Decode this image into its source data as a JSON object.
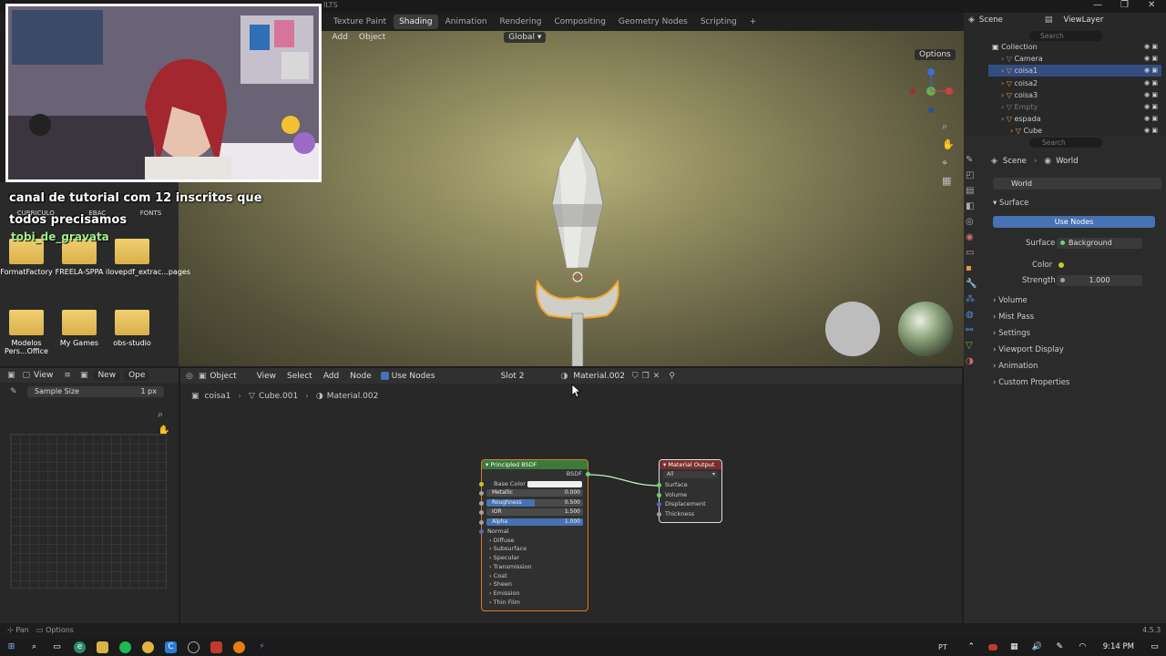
{
  "titlebar": {
    "title_fragment": "ILTS",
    "minimize": "—",
    "restore": "❐",
    "close": "✕"
  },
  "workspace_tabs": [
    "Texture Paint",
    "Shading",
    "Animation",
    "Rendering",
    "Compositing",
    "Geometry Nodes",
    "Scripting"
  ],
  "active_workspace": "Shading",
  "add_workspace": "+",
  "scene_selector": {
    "scene": "Scene",
    "view_layer": "ViewLayer"
  },
  "viewport": {
    "menu": [
      "ct",
      "Add",
      "Object"
    ],
    "orientation": "Global",
    "options_label": "Options"
  },
  "webcam_overlay": {
    "caption": "canal de tutorial com 12 inscritos que todos precisamos",
    "username": "tobi_de_gravata"
  },
  "desktop": {
    "top_labels": [
      "CURRICULO",
      "EBAC",
      "FONTS"
    ],
    "folders_row1": [
      "FormatFactory",
      "FREELA-SPPA",
      "ilovepdf_extrac...pages"
    ],
    "folders_row2": [
      "Modelos Pers...Office",
      "My Games",
      "obs-studio"
    ]
  },
  "image_editor": {
    "view_label": "View",
    "new_label": "New",
    "open_label": "Ope",
    "sample_size_label": "Sample Size",
    "sample_size_value": "1 px"
  },
  "node_editor": {
    "object_mode": "Object",
    "menus": [
      "View",
      "Select",
      "Add",
      "Node"
    ],
    "use_nodes_label": "Use Nodes",
    "slot": "Slot 2",
    "material_name": "Material.002",
    "breadcrumb": [
      "coisa1",
      "Cube.001",
      "Material.002"
    ]
  },
  "principled_bsdf": {
    "title": "Principled BSDF",
    "output": "BSDF",
    "inputs": [
      {
        "name": "Base Color",
        "value": ""
      },
      {
        "name": "Metallic",
        "value": "0.000"
      },
      {
        "name": "Roughness",
        "value": "0.500"
      },
      {
        "name": "IOR",
        "value": "1.500"
      },
      {
        "name": "Alpha",
        "value": "1.000"
      }
    ],
    "normal_label": "Normal",
    "sections": [
      "Diffuse",
      "Subsurface",
      "Specular",
      "Transmission",
      "Coat",
      "Sheen",
      "Emission",
      "Thin Film"
    ]
  },
  "material_output": {
    "title": "Material Output",
    "target": "All",
    "inputs": [
      "Surface",
      "Volume",
      "Displacement",
      "Thickness"
    ]
  },
  "outliner": {
    "search_placeholder": "Search",
    "items": [
      {
        "label": "Collection",
        "indent": 0
      },
      {
        "label": "Camera",
        "indent": 1
      },
      {
        "label": "coisa1",
        "indent": 1,
        "selected": true
      },
      {
        "label": "coisa2",
        "indent": 1
      },
      {
        "label": "coisa3",
        "indent": 1
      },
      {
        "label": "Empty",
        "indent": 1
      },
      {
        "label": "espada",
        "indent": 1
      },
      {
        "label": "Cube",
        "indent": 2
      }
    ]
  },
  "properties": {
    "search_placeholder": "Search",
    "breadcrumb": [
      "Scene",
      "World"
    ],
    "world_name": "World",
    "surface_panel": "Surface",
    "use_nodes_button": "Use Nodes",
    "surface_label": "Surface",
    "surface_value": "Background",
    "color_label": "Color",
    "strength_label": "Strength",
    "strength_value": "1.000",
    "collapsed_panels": [
      "Volume",
      "Mist Pass",
      "Settings",
      "Viewport Display",
      "Animation",
      "Custom Properties"
    ]
  },
  "status_bar": {
    "left": [
      "Pan",
      "Options"
    ],
    "version": "4.5.3"
  },
  "taskbar": {
    "lang": "PT",
    "time": "9:14 PM"
  },
  "colors": {
    "accent_blue": "#4772b3",
    "selected_row": "#334d80",
    "node_green_header": "#3b7a3a",
    "node_red_header": "#7a2f2f",
    "selection_orange": "#f5a623"
  }
}
